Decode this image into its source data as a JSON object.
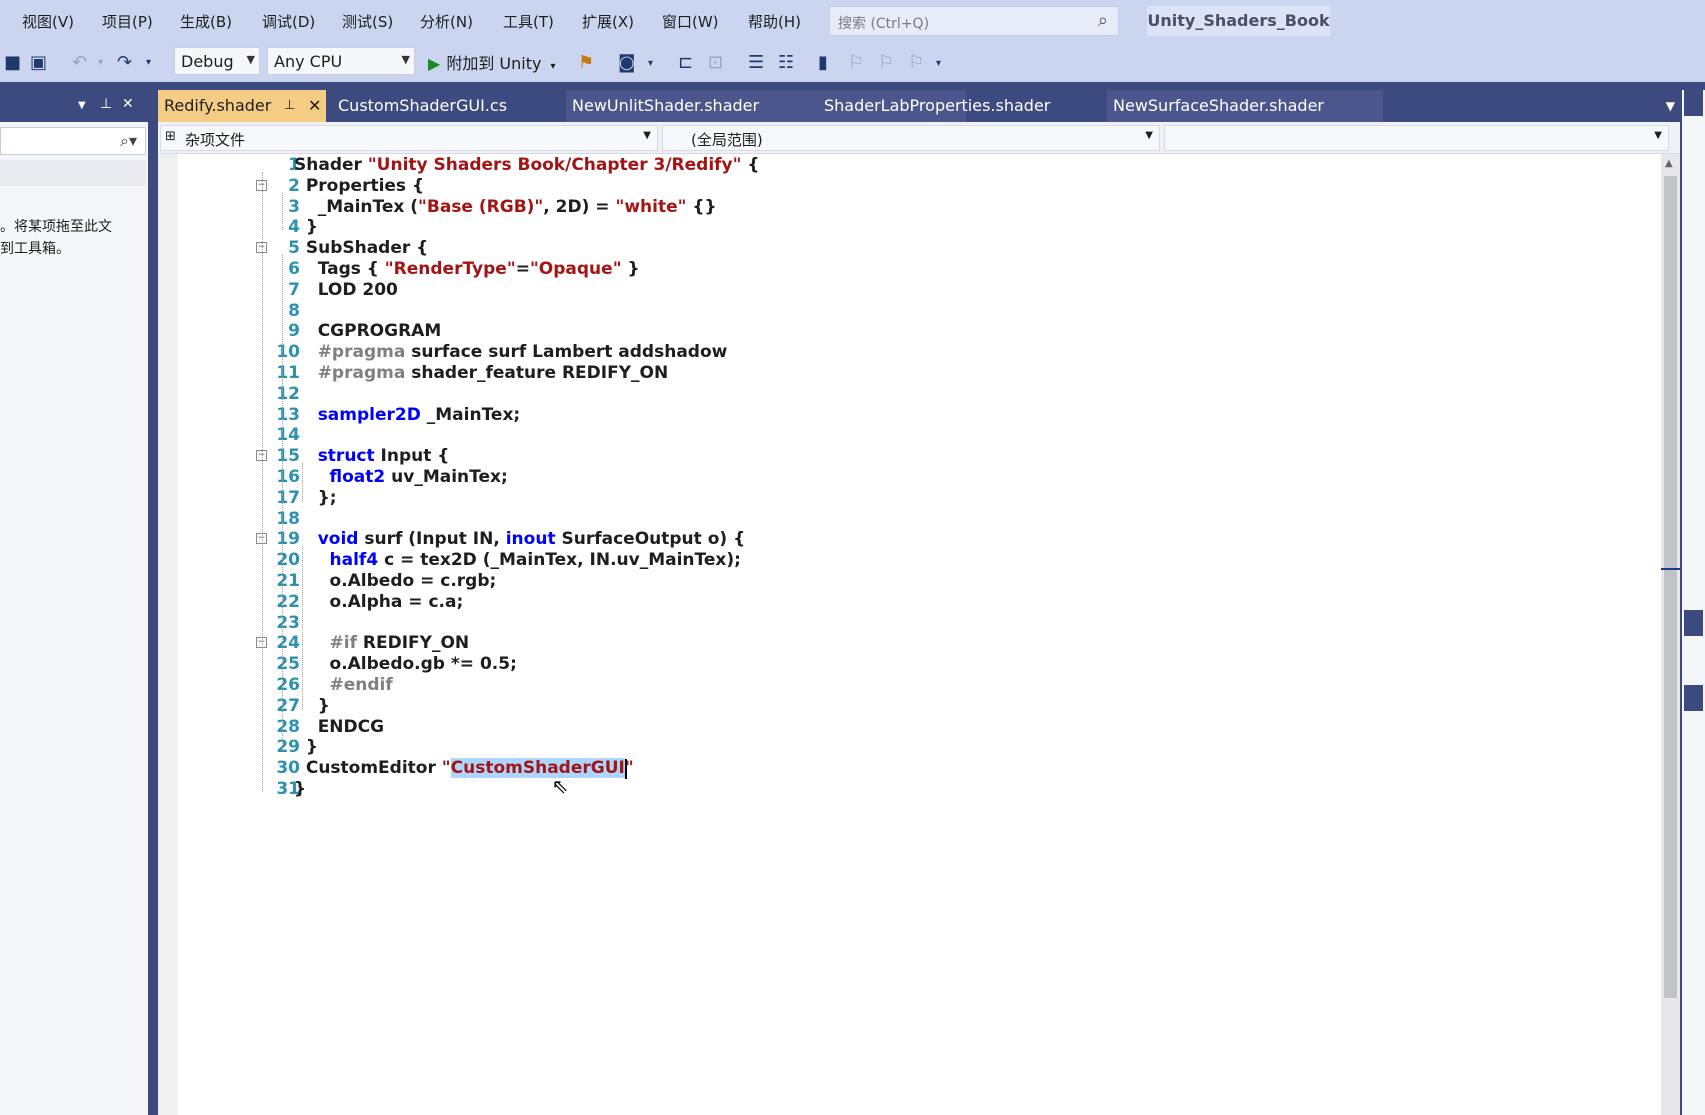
{
  "menu": {
    "items": [
      "视图(V)",
      "项目(P)",
      "生成(B)",
      "调试(D)",
      "测试(S)",
      "分析(N)",
      "工具(T)",
      "扩展(X)",
      "窗口(W)",
      "帮助(H)"
    ],
    "search_placeholder": "搜索 (Ctrl+Q)",
    "solution_name": "Unity_Shaders_Book"
  },
  "toolbar": {
    "configuration": "Debug",
    "platform": "Any CPU",
    "attach_label": "附加到 Unity"
  },
  "left_panel": {
    "message_lines": [
      "。将某项拖至此文",
      "到工具箱。"
    ]
  },
  "tabs": [
    {
      "label": "Redify.shader",
      "active": true
    },
    {
      "label": "CustomShaderGUI.cs",
      "active": false
    },
    {
      "label": "NewUnlitShader.shader",
      "active": false
    },
    {
      "label": "ShaderLabProperties.shader",
      "active": false
    },
    {
      "label": "NewSurfaceShader.shader",
      "active": false
    }
  ],
  "nav": {
    "project_scope": "杂项文件",
    "member_scope": "(全局范围)"
  },
  "editor": {
    "lines": [
      {
        "n": "1",
        "indent": "",
        "tokens": [
          [
            "t",
            "Shader "
          ],
          [
            "s",
            "\"Unity Shaders Book/Chapter 3/Redify\""
          ],
          [
            "t",
            " {"
          ]
        ]
      },
      {
        "n": "2",
        "indent": "  ",
        "tokens": [
          [
            "t",
            "Properties {"
          ]
        ]
      },
      {
        "n": "3",
        "indent": "    ",
        "tokens": [
          [
            "t",
            "_MainTex ("
          ],
          [
            "s",
            "\"Base (RGB)\""
          ],
          [
            "t",
            ", 2D) = "
          ],
          [
            "s",
            "\"white\""
          ],
          [
            "t",
            " {}"
          ]
        ]
      },
      {
        "n": "4",
        "indent": "  ",
        "tokens": [
          [
            "t",
            "}"
          ]
        ]
      },
      {
        "n": "5",
        "indent": "  ",
        "tokens": [
          [
            "t",
            "SubShader {"
          ]
        ]
      },
      {
        "n": "6",
        "indent": "    ",
        "tokens": [
          [
            "t",
            "Tags { "
          ],
          [
            "s",
            "\"RenderType\""
          ],
          [
            "t",
            "="
          ],
          [
            "s",
            "\"Opaque\""
          ],
          [
            "t",
            " }"
          ]
        ]
      },
      {
        "n": "7",
        "indent": "    ",
        "tokens": [
          [
            "t",
            "LOD 200"
          ]
        ]
      },
      {
        "n": "8",
        "indent": "",
        "tokens": []
      },
      {
        "n": "9",
        "indent": "    ",
        "tokens": [
          [
            "t",
            "CGPROGRAM"
          ]
        ]
      },
      {
        "n": "10",
        "indent": "    ",
        "tokens": [
          [
            "p",
            "#pragma"
          ],
          [
            "t",
            " surface surf Lambert addshadow"
          ]
        ]
      },
      {
        "n": "11",
        "indent": "    ",
        "tokens": [
          [
            "p",
            "#pragma"
          ],
          [
            "t",
            " shader_feature REDIFY_ON"
          ]
        ]
      },
      {
        "n": "12",
        "indent": "",
        "tokens": []
      },
      {
        "n": "13",
        "indent": "    ",
        "tokens": [
          [
            "k",
            "sampler2D"
          ],
          [
            "t",
            " _MainTex;"
          ]
        ]
      },
      {
        "n": "14",
        "indent": "",
        "tokens": []
      },
      {
        "n": "15",
        "indent": "    ",
        "tokens": [
          [
            "k",
            "struct"
          ],
          [
            "t",
            " Input {"
          ]
        ]
      },
      {
        "n": "16",
        "indent": "      ",
        "tokens": [
          [
            "k",
            "float2"
          ],
          [
            "t",
            " uv_MainTex;"
          ]
        ]
      },
      {
        "n": "17",
        "indent": "    ",
        "tokens": [
          [
            "t",
            "};"
          ]
        ]
      },
      {
        "n": "18",
        "indent": "",
        "tokens": []
      },
      {
        "n": "19",
        "indent": "    ",
        "tokens": [
          [
            "k",
            "void"
          ],
          [
            "t",
            " surf (Input IN, "
          ],
          [
            "k",
            "inout"
          ],
          [
            "t",
            " SurfaceOutput o) {"
          ]
        ]
      },
      {
        "n": "20",
        "indent": "      ",
        "tokens": [
          [
            "k",
            "half4"
          ],
          [
            "t",
            " c = tex2D (_MainTex, IN.uv_MainTex);"
          ]
        ]
      },
      {
        "n": "21",
        "indent": "      ",
        "tokens": [
          [
            "t",
            "o.Albedo = c.rgb;"
          ]
        ]
      },
      {
        "n": "22",
        "indent": "      ",
        "tokens": [
          [
            "t",
            "o.Alpha = c.a;"
          ]
        ]
      },
      {
        "n": "23",
        "indent": "",
        "tokens": []
      },
      {
        "n": "24",
        "indent": "      ",
        "tokens": [
          [
            "p",
            "#if"
          ],
          [
            "t",
            " REDIFY_ON"
          ]
        ]
      },
      {
        "n": "25",
        "indent": "      ",
        "tokens": [
          [
            "t",
            "o.Albedo.gb *= 0.5;"
          ]
        ]
      },
      {
        "n": "26",
        "indent": "      ",
        "tokens": [
          [
            "p",
            "#endif"
          ]
        ]
      },
      {
        "n": "27",
        "indent": "    ",
        "tokens": [
          [
            "t",
            "}"
          ]
        ]
      },
      {
        "n": "28",
        "indent": "    ",
        "tokens": [
          [
            "t",
            "ENDCG"
          ]
        ]
      },
      {
        "n": "29",
        "indent": "  ",
        "tokens": [
          [
            "t",
            "}"
          ]
        ]
      },
      {
        "n": "30",
        "indent": "  ",
        "tokens": [
          [
            "t",
            "CustomEditor "
          ],
          [
            "s",
            "\""
          ],
          [
            "sel",
            "CustomShaderGUI"
          ],
          [
            "s",
            "\""
          ]
        ]
      },
      {
        "n": "31",
        "indent": "",
        "tokens": [
          [
            "t",
            "}"
          ]
        ]
      }
    ]
  },
  "colors": {
    "keyword": "#0000ff",
    "string": "#a31515",
    "preprocessor": "#808080",
    "line_number": "#2b91af",
    "active_tab": "#f5cc84",
    "chrome_dark": "#3d4a80",
    "chrome_light": "#ccd5f0"
  }
}
